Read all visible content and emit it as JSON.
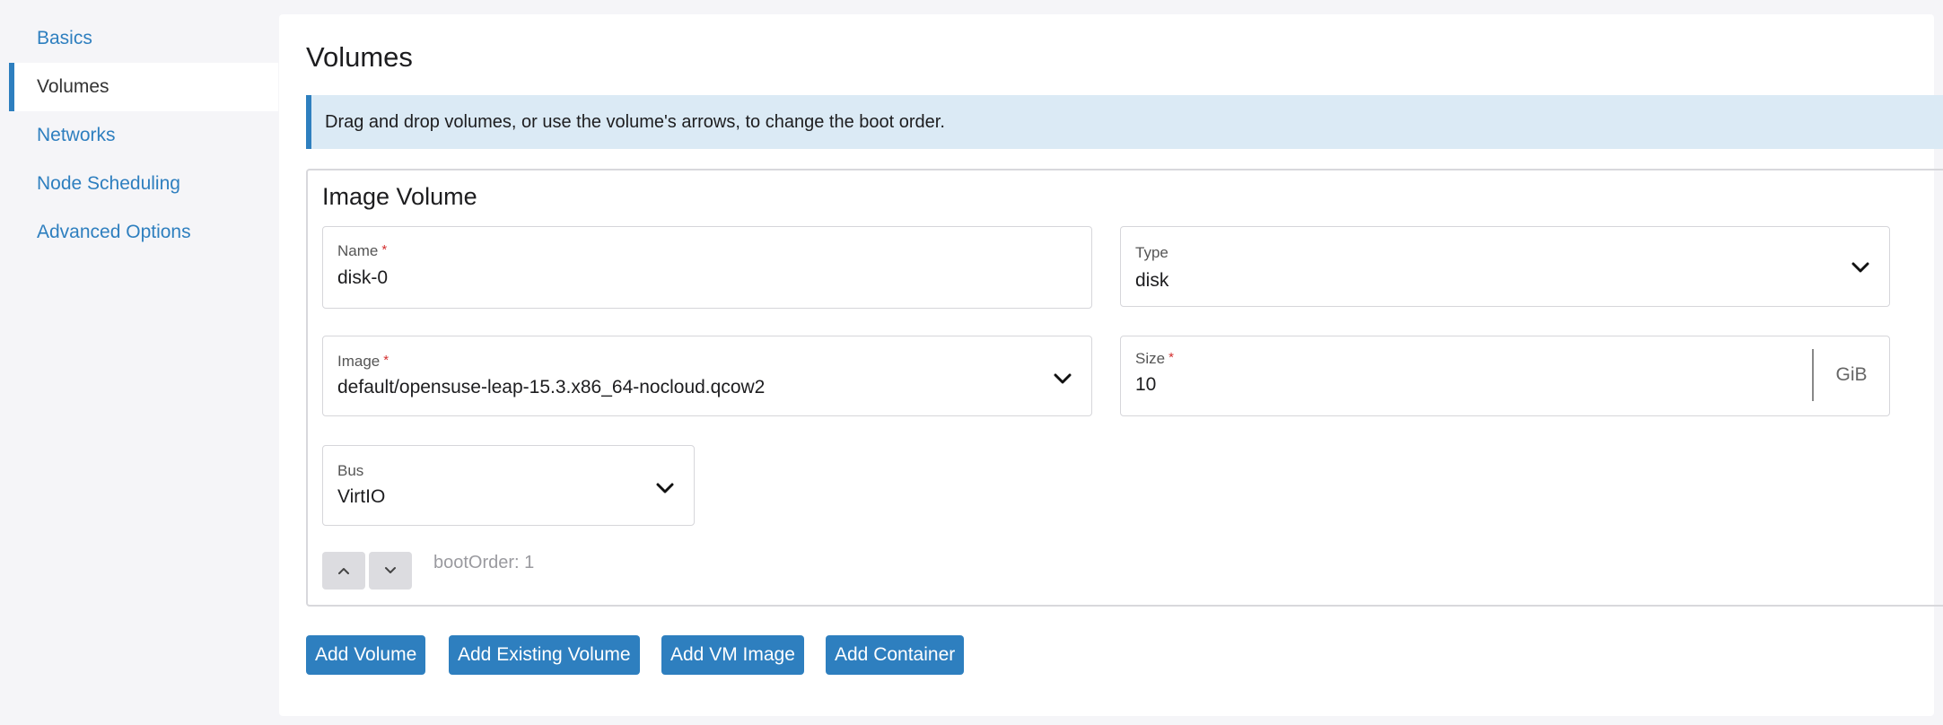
{
  "sidebar": {
    "items": [
      {
        "label": "Basics"
      },
      {
        "label": "Volumes"
      },
      {
        "label": "Networks"
      },
      {
        "label": "Node Scheduling"
      },
      {
        "label": "Advanced Options"
      }
    ],
    "active_index": 1
  },
  "main": {
    "title": "Volumes",
    "banner": "Drag and drop volumes, or use the volume's arrows, to change the boot order.",
    "volume": {
      "title": "Image Volume",
      "name": {
        "label": "Name",
        "required_mark": "*",
        "value": "disk-0"
      },
      "type": {
        "label": "Type",
        "value": "disk"
      },
      "image": {
        "label": "Image",
        "required_mark": "*",
        "value": "default/opensuse-leap-15.3.x86_64-nocloud.qcow2"
      },
      "size": {
        "label": "Size",
        "required_mark": "*",
        "value": "10",
        "unit": "GiB"
      },
      "bus": {
        "label": "Bus",
        "value": "VirtIO"
      },
      "boot_order": "bootOrder: 1"
    },
    "buttons": {
      "add_volume": "Add Volume",
      "add_existing_volume": "Add Existing Volume",
      "add_vm_image": "Add VM Image",
      "add_container": "Add Container"
    }
  },
  "colors": {
    "accent": "#2e7fbf",
    "banner_bg": "#dbeaf5",
    "required": "#d32f2f"
  },
  "icons": [
    "close-icon",
    "chevron-down-icon",
    "arrow-up-icon",
    "arrow-down-icon"
  ]
}
